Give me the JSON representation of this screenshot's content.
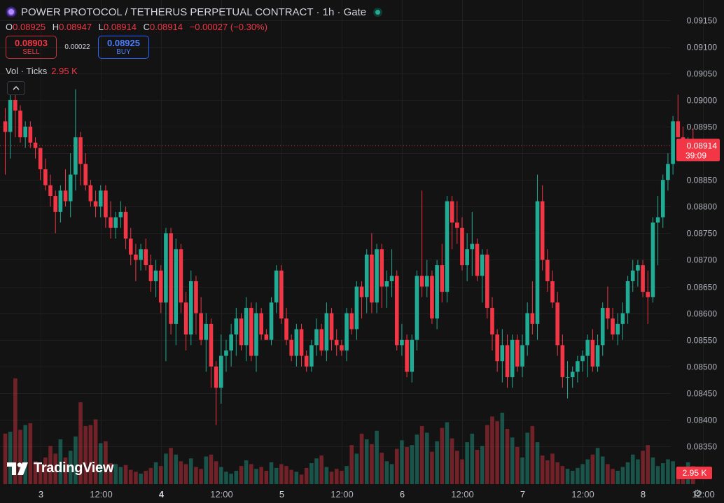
{
  "header": {
    "title": "POWER PROTOCOL / TETHERUS PERPETUAL CONTRACT · 1h · Gate"
  },
  "ohlc": {
    "o_label": "O",
    "o_value": "0.08925",
    "h_label": "H",
    "h_value": "0.08947",
    "l_label": "L",
    "l_value": "0.08914",
    "c_label": "C",
    "c_value": "0.08914",
    "change": "−0.00027 (−0.30%)"
  },
  "trade": {
    "sell_price": "0.08903",
    "sell_label": "SELL",
    "spread": "0.00022",
    "buy_price": "0.08925",
    "buy_label": "BUY"
  },
  "volume_indicator": {
    "label": "Vol · Ticks",
    "value": "2.95 K"
  },
  "watermark": {
    "text": "TradingView"
  },
  "colors": {
    "up": "#22ab94",
    "down": "#f23645",
    "background": "#131313",
    "grid": "#1f1f1f",
    "text": "#b2b5be"
  },
  "chart_data": {
    "type": "candlestick",
    "interval": "1h",
    "price_axis": {
      "min": 0.0832,
      "max": 0.0916,
      "ticks": [
        "0.09150",
        "0.09100",
        "0.09050",
        "0.09000",
        "0.08950",
        "0.08900",
        "0.08850",
        "0.08800",
        "0.08750",
        "0.08700",
        "0.08650",
        "0.08600",
        "0.08550",
        "0.08500",
        "0.08450",
        "0.08400",
        "0.08350"
      ]
    },
    "time_axis": {
      "labels": [
        {
          "text": "3",
          "bar": 7
        },
        {
          "text": "12:00",
          "bar": 19
        },
        {
          "text": "4",
          "bar": 31
        },
        {
          "text": "12:00",
          "bar": 43
        },
        {
          "text": "5",
          "bar": 55
        },
        {
          "text": "12:00",
          "bar": 67
        },
        {
          "text": "6",
          "bar": 79
        },
        {
          "text": "12:00",
          "bar": 91
        },
        {
          "text": "7",
          "bar": 103
        },
        {
          "text": "12:00",
          "bar": 115
        },
        {
          "text": "8",
          "bar": 127
        },
        {
          "text": "12:00",
          "bar": 139
        },
        {
          "text": "9",
          "bar": 151
        }
      ]
    },
    "last_price": {
      "value": 0.08914,
      "label": "0.08914",
      "countdown": "39:09"
    },
    "last_volume": {
      "label": "2.95 K"
    },
    "grid": true,
    "candles": [
      [
        0.0896,
        0.08985,
        0.0886,
        0.0894
      ],
      [
        0.0894,
        0.0901,
        0.0889,
        0.09
      ],
      [
        0.09,
        0.0901,
        0.0893,
        0.0898
      ],
      [
        0.0898,
        0.0899,
        0.0892,
        0.0893
      ],
      [
        0.0893,
        0.0896,
        0.0891,
        0.0895
      ],
      [
        0.0895,
        0.0896,
        0.0891,
        0.0892
      ],
      [
        0.0892,
        0.0893,
        0.0889,
        0.0891
      ],
      [
        0.0891,
        0.0891,
        0.0885,
        0.0887
      ],
      [
        0.0887,
        0.0889,
        0.0883,
        0.0884
      ],
      [
        0.0884,
        0.0886,
        0.088,
        0.0882
      ],
      [
        0.0882,
        0.0883,
        0.0875,
        0.0879
      ],
      [
        0.0879,
        0.0884,
        0.0877,
        0.0883
      ],
      [
        0.0883,
        0.0887,
        0.088,
        0.0881
      ],
      [
        0.0881,
        0.089,
        0.0878,
        0.0886
      ],
      [
        0.0886,
        0.0902,
        0.0883,
        0.0893
      ],
      [
        0.0893,
        0.0894,
        0.0884,
        0.0888
      ],
      [
        0.0888,
        0.089,
        0.0883,
        0.0884
      ],
      [
        0.0884,
        0.0885,
        0.088,
        0.0881
      ],
      [
        0.0881,
        0.0883,
        0.0878,
        0.088
      ],
      [
        0.088,
        0.0884,
        0.0878,
        0.0883
      ],
      [
        0.0883,
        0.0884,
        0.0876,
        0.0878
      ],
      [
        0.0878,
        0.0881,
        0.0874,
        0.0876
      ],
      [
        0.0876,
        0.0879,
        0.0874,
        0.0878
      ],
      [
        0.0878,
        0.0881,
        0.0876,
        0.0879
      ],
      [
        0.0879,
        0.088,
        0.0872,
        0.0874
      ],
      [
        0.0874,
        0.0876,
        0.0869,
        0.0871
      ],
      [
        0.0871,
        0.0873,
        0.0866,
        0.087
      ],
      [
        0.087,
        0.0873,
        0.0868,
        0.0872
      ],
      [
        0.0872,
        0.0874,
        0.0868,
        0.0869
      ],
      [
        0.0869,
        0.0871,
        0.0864,
        0.0866
      ],
      [
        0.0866,
        0.087,
        0.0863,
        0.0868
      ],
      [
        0.0868,
        0.0869,
        0.086,
        0.0862
      ],
      [
        0.0862,
        0.0876,
        0.0851,
        0.0875
      ],
      [
        0.0875,
        0.0876,
        0.0856,
        0.0858
      ],
      [
        0.0858,
        0.0874,
        0.0854,
        0.0872
      ],
      [
        0.0872,
        0.0873,
        0.086,
        0.0862
      ],
      [
        0.0862,
        0.0864,
        0.0853,
        0.0856
      ],
      [
        0.0856,
        0.0868,
        0.0854,
        0.0866
      ],
      [
        0.0866,
        0.0867,
        0.0856,
        0.086
      ],
      [
        0.086,
        0.0863,
        0.0854,
        0.0855
      ],
      [
        0.0855,
        0.086,
        0.0849,
        0.0858
      ],
      [
        0.0858,
        0.0859,
        0.0846,
        0.085
      ],
      [
        0.085,
        0.0851,
        0.0839,
        0.0846
      ],
      [
        0.0846,
        0.0856,
        0.0843,
        0.0852
      ],
      [
        0.0852,
        0.0855,
        0.0849,
        0.0853
      ],
      [
        0.0853,
        0.0858,
        0.085,
        0.0856
      ],
      [
        0.0856,
        0.0861,
        0.0852,
        0.0859
      ],
      [
        0.0859,
        0.086,
        0.0853,
        0.0854
      ],
      [
        0.0854,
        0.0863,
        0.0851,
        0.0861
      ],
      [
        0.0861,
        0.0862,
        0.0851,
        0.0852
      ],
      [
        0.0852,
        0.0862,
        0.0849,
        0.086
      ],
      [
        0.086,
        0.0861,
        0.0855,
        0.0856
      ],
      [
        0.0856,
        0.0857,
        0.0855,
        0.0855
      ],
      [
        0.0855,
        0.0863,
        0.0854,
        0.0862
      ],
      [
        0.0862,
        0.0869,
        0.086,
        0.0868
      ],
      [
        0.0868,
        0.0869,
        0.0858,
        0.0859
      ],
      [
        0.0859,
        0.0861,
        0.0854,
        0.0855
      ],
      [
        0.0855,
        0.0856,
        0.0851,
        0.0852
      ],
      [
        0.0852,
        0.0858,
        0.085,
        0.0857
      ],
      [
        0.0857,
        0.0858,
        0.085,
        0.0852
      ],
      [
        0.0852,
        0.0853,
        0.0849,
        0.085
      ],
      [
        0.085,
        0.0855,
        0.0849,
        0.0854
      ],
      [
        0.0854,
        0.0859,
        0.0852,
        0.0857
      ],
      [
        0.0857,
        0.0858,
        0.0852,
        0.0853
      ],
      [
        0.0853,
        0.0862,
        0.0851,
        0.086
      ],
      [
        0.086,
        0.0861,
        0.0853,
        0.0855
      ],
      [
        0.0855,
        0.0857,
        0.0852,
        0.0854
      ],
      [
        0.0854,
        0.0855,
        0.0852,
        0.0853
      ],
      [
        0.0853,
        0.0861,
        0.0851,
        0.086
      ],
      [
        0.086,
        0.0861,
        0.0856,
        0.0857
      ],
      [
        0.0857,
        0.0866,
        0.0855,
        0.0865
      ],
      [
        0.0865,
        0.0866,
        0.0859,
        0.0863
      ],
      [
        0.0863,
        0.0872,
        0.086,
        0.0871
      ],
      [
        0.0871,
        0.0875,
        0.086,
        0.0862
      ],
      [
        0.0862,
        0.0873,
        0.086,
        0.0872
      ],
      [
        0.0872,
        0.0873,
        0.0861,
        0.0865
      ],
      [
        0.0865,
        0.0868,
        0.0861,
        0.0866
      ],
      [
        0.0866,
        0.0872,
        0.0863,
        0.0867
      ],
      [
        0.0867,
        0.0868,
        0.0853,
        0.0854
      ],
      [
        0.0854,
        0.0858,
        0.0852,
        0.0855
      ],
      [
        0.0855,
        0.0856,
        0.0848,
        0.0849
      ],
      [
        0.0849,
        0.0856,
        0.0847,
        0.0855
      ],
      [
        0.0855,
        0.0868,
        0.0853,
        0.0867
      ],
      [
        0.0867,
        0.0883,
        0.0863,
        0.0865
      ],
      [
        0.0865,
        0.087,
        0.0863,
        0.0867
      ],
      [
        0.0867,
        0.0868,
        0.0858,
        0.0859
      ],
      [
        0.0859,
        0.087,
        0.0857,
        0.0869
      ],
      [
        0.0869,
        0.0873,
        0.0862,
        0.0864
      ],
      [
        0.0864,
        0.0882,
        0.0862,
        0.0881
      ],
      [
        0.0881,
        0.0882,
        0.0872,
        0.0877
      ],
      [
        0.0877,
        0.0881,
        0.0873,
        0.0876
      ],
      [
        0.0876,
        0.0878,
        0.0868,
        0.0869
      ],
      [
        0.0869,
        0.0875,
        0.0866,
        0.0872
      ],
      [
        0.0872,
        0.0879,
        0.0867,
        0.0873
      ],
      [
        0.0873,
        0.0874,
        0.0866,
        0.0867
      ],
      [
        0.0867,
        0.0872,
        0.0862,
        0.0871
      ],
      [
        0.0871,
        0.0872,
        0.0859,
        0.0861
      ],
      [
        0.0861,
        0.0863,
        0.0853,
        0.0856
      ],
      [
        0.0856,
        0.0857,
        0.0849,
        0.0851
      ],
      [
        0.0851,
        0.0857,
        0.0847,
        0.0854
      ],
      [
        0.0854,
        0.0856,
        0.0846,
        0.0848
      ],
      [
        0.0848,
        0.0856,
        0.0846,
        0.0855
      ],
      [
        0.0855,
        0.0856,
        0.0849,
        0.085
      ],
      [
        0.085,
        0.0856,
        0.0848,
        0.0854
      ],
      [
        0.0854,
        0.0862,
        0.0852,
        0.086
      ],
      [
        0.086,
        0.0866,
        0.0856,
        0.0858
      ],
      [
        0.0858,
        0.0886,
        0.0855,
        0.0881
      ],
      [
        0.0881,
        0.0884,
        0.0868,
        0.087
      ],
      [
        0.087,
        0.0872,
        0.0864,
        0.0866
      ],
      [
        0.0866,
        0.0868,
        0.0861,
        0.0862
      ],
      [
        0.0862,
        0.0864,
        0.0852,
        0.0854
      ],
      [
        0.0854,
        0.0856,
        0.0846,
        0.0848
      ],
      [
        0.0848,
        0.0851,
        0.0844,
        0.0848
      ],
      [
        0.0848,
        0.085,
        0.0846,
        0.0849
      ],
      [
        0.0849,
        0.0852,
        0.0847,
        0.0851
      ],
      [
        0.0851,
        0.0853,
        0.0849,
        0.0852
      ],
      [
        0.0852,
        0.0856,
        0.0848,
        0.0855
      ],
      [
        0.0855,
        0.0857,
        0.0849,
        0.085
      ],
      [
        0.085,
        0.0856,
        0.0849,
        0.0854
      ],
      [
        0.0854,
        0.0862,
        0.0852,
        0.0861
      ],
      [
        0.0861,
        0.0865,
        0.0857,
        0.0859
      ],
      [
        0.0859,
        0.0861,
        0.0855,
        0.0856
      ],
      [
        0.0856,
        0.086,
        0.0854,
        0.0858
      ],
      [
        0.0858,
        0.0862,
        0.0855,
        0.086
      ],
      [
        0.086,
        0.0867,
        0.0858,
        0.0866
      ],
      [
        0.0866,
        0.087,
        0.0864,
        0.0868
      ],
      [
        0.0868,
        0.087,
        0.0865,
        0.0869
      ],
      [
        0.0869,
        0.087,
        0.0863,
        0.0864
      ],
      [
        0.0864,
        0.0868,
        0.0858,
        0.0863
      ],
      [
        0.0863,
        0.0878,
        0.0862,
        0.0877
      ],
      [
        0.0877,
        0.0882,
        0.0869,
        0.0878
      ],
      [
        0.0878,
        0.0886,
        0.0876,
        0.0885
      ],
      [
        0.0885,
        0.089,
        0.0883,
        0.0888
      ],
      [
        0.0888,
        0.0897,
        0.0886,
        0.0896
      ],
      [
        0.0896,
        0.0901,
        0.0893,
        0.0893
      ],
      [
        0.0893,
        0.0895,
        0.089,
        0.0891
      ],
      [
        0.0891,
        0.0893,
        0.089,
        0.0892
      ],
      [
        0.08925,
        0.08947,
        0.08914,
        0.08914
      ]
    ],
    "volume_max": 13000,
    "volumes": [
      5300,
      5500,
      11100,
      5700,
      6200,
      6400,
      2400,
      2100,
      2800,
      4000,
      3200,
      4700,
      2800,
      3500,
      5000,
      8600,
      6100,
      6200,
      6800,
      4300,
      4500,
      2200,
      2100,
      1800,
      2000,
      1500,
      1300,
      1100,
      1400,
      1700,
      2300,
      1900,
      3200,
      3800,
      3100,
      2400,
      2100,
      2700,
      1800,
      1600,
      2900,
      3100,
      2400,
      1800,
      1300,
      1100,
      1400,
      1900,
      2500,
      2100,
      1600,
      1800,
      1400,
      2300,
      1700,
      2100,
      1900,
      1500,
      1300,
      1000,
      1700,
      2200,
      2700,
      3000,
      1800,
      1300,
      1600,
      1400,
      1900,
      4100,
      3200,
      5300,
      4700,
      4200,
      5600,
      3300,
      2400,
      2100,
      3700,
      4600,
      3900,
      4100,
      5200,
      6100,
      5400,
      3400,
      4500,
      5900,
      6500,
      4800,
      3500,
      2600,
      4400,
      5300,
      3600,
      4000,
      6200,
      7100,
      6600,
      7500,
      5800,
      4900,
      3900,
      2800,
      5400,
      6100,
      4400,
      3000,
      2500,
      3200,
      2300,
      1900,
      1600,
      1400,
      1700,
      2100,
      2600,
      3100,
      3800,
      2900,
      2100,
      1600,
      1400,
      1800,
      2300,
      3100,
      2600,
      3500,
      4100,
      2800,
      1900,
      2200,
      2600,
      2400,
      1700,
      1500,
      2300,
      1900,
      2600,
      1800,
      2950
    ]
  }
}
